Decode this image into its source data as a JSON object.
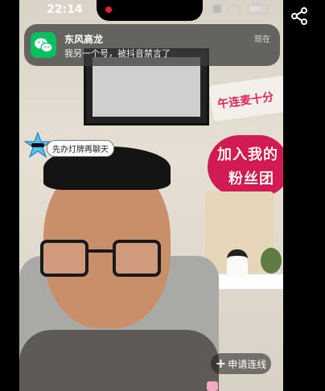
{
  "status_bar": {
    "time": "22:14"
  },
  "notification": {
    "app_icon": "wechat-icon",
    "title": "东风高龙",
    "message": "我另一个号，被抖音禁言了",
    "time": "现在"
  },
  "overlay": {
    "sticker_text": "先办灯牌再聊天",
    "request_button_label": "申请连线",
    "share_icon": "share-icon"
  },
  "scene": {
    "sign_text": "午连麦十分",
    "fans_banner_line1": "加入我的",
    "fans_banner_line2": "粉丝团"
  },
  "colors": {
    "wechat_green": "#07c160",
    "banner_pink": "#d21b55"
  }
}
